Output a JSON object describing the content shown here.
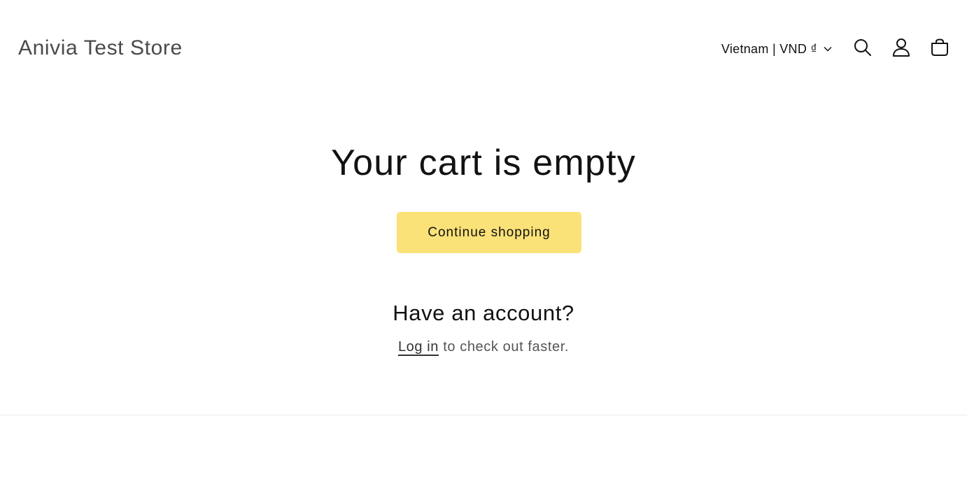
{
  "header": {
    "store_name": "Anivia Test Store",
    "locale_label": "Vietnam | VND ₫",
    "icons": [
      "chevron-down-icon",
      "search-icon",
      "account-icon",
      "cart-icon"
    ]
  },
  "cart": {
    "title": "Your cart is empty",
    "continue_label": "Continue shopping",
    "account_heading": "Have an account?",
    "login_link": "Log in",
    "login_suffix": " to check out faster."
  },
  "colors": {
    "button_bg": "#fbe278",
    "text": "#121212",
    "divider": "#ececec"
  }
}
